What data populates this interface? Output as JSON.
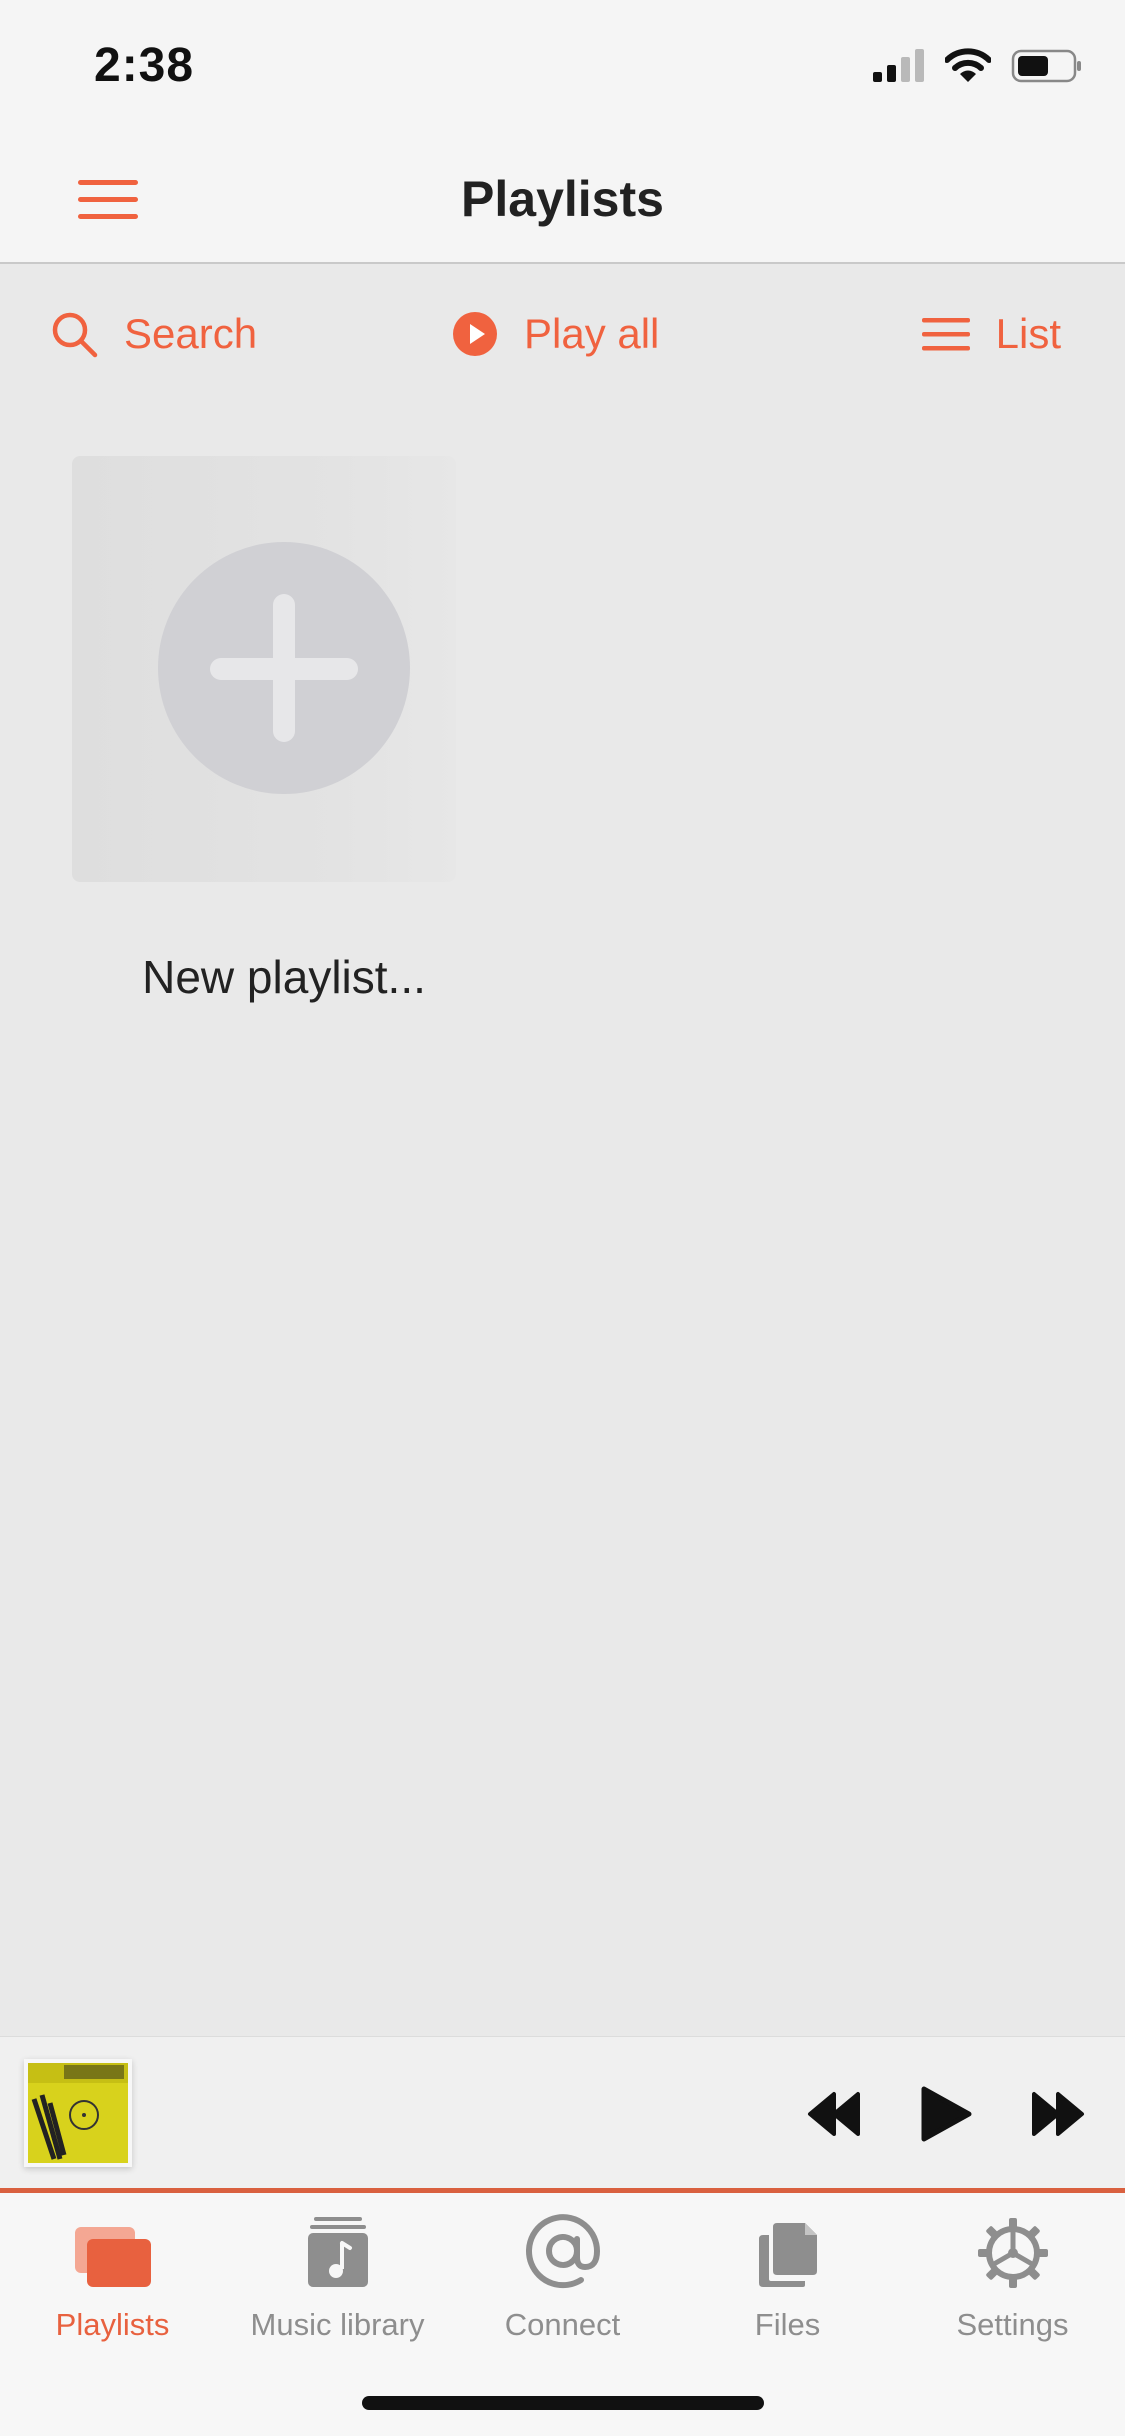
{
  "status_bar": {
    "time": "2:38"
  },
  "nav": {
    "title": "Playlists"
  },
  "toolbar": {
    "search_label": "Search",
    "play_all_label": "Play all",
    "list_label": "List"
  },
  "content": {
    "new_playlist_label": "New playlist..."
  },
  "tabs": [
    {
      "label": "Playlists",
      "icon": "playlists-icon",
      "active": true
    },
    {
      "label": "Music library",
      "icon": "music-library-icon",
      "active": false
    },
    {
      "label": "Connect",
      "icon": "at-sign-icon",
      "active": false
    },
    {
      "label": "Files",
      "icon": "files-icon",
      "active": false
    },
    {
      "label": "Settings",
      "icon": "gear-icon",
      "active": false
    }
  ],
  "colors": {
    "accent": "#f0623f",
    "tab_active": "#e8613f",
    "tab_inactive": "#8e8e8e",
    "background": "#e9e9e9"
  }
}
